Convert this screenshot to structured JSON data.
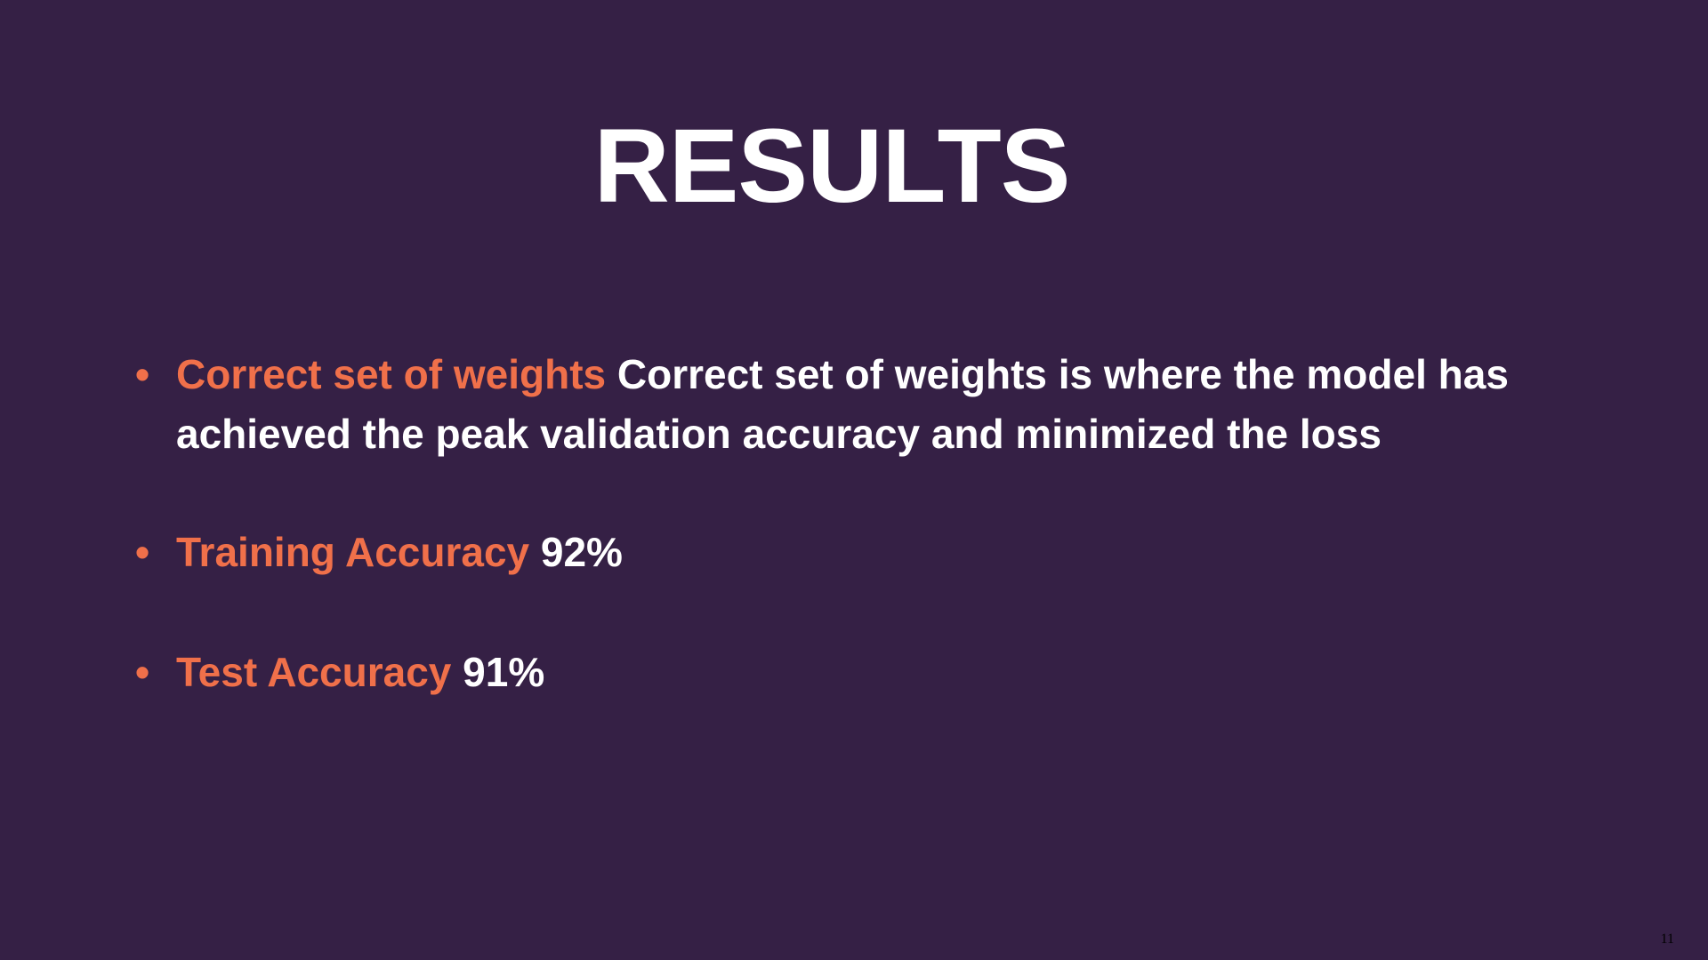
{
  "slide": {
    "title": "RESULTS",
    "page_number": "11",
    "colors": {
      "background": "#352045",
      "accent": "#f0704a",
      "text": "#ffffff"
    },
    "bullets": [
      {
        "icon": "bullet-dot",
        "highlight": "Correct set of weights",
        "text": "Correct set of weights is where the model has achieved the peak validation accuracy and minimized the loss"
      },
      {
        "icon": "bullet-dot",
        "highlight": "Training Accuracy",
        "text": "92%"
      },
      {
        "icon": "bullet-dot",
        "highlight": "Test Accuracy",
        "text": "91%"
      }
    ]
  }
}
